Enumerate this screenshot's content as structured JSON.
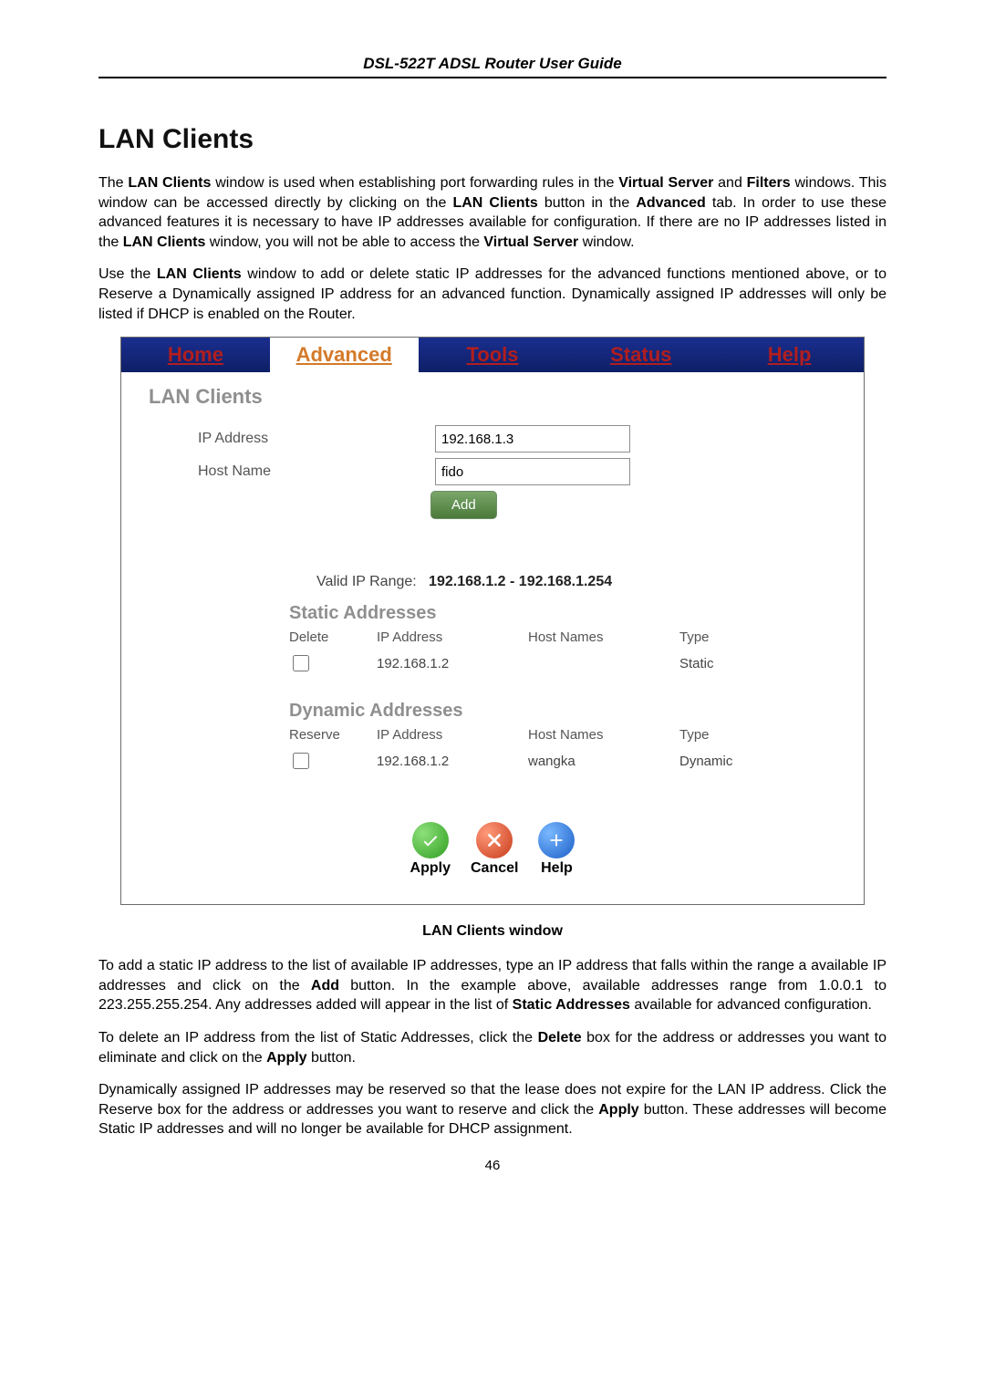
{
  "doc": {
    "header": "DSL-522T ADSL Router User Guide",
    "section_title": "LAN Clients",
    "para1_a": "The ",
    "para1_b": "LAN Clients",
    "para1_c": " window is used when establishing port forwarding rules in the ",
    "para1_d": "Virtual Server",
    "para1_e": " and ",
    "para1_f": "Filters",
    "para1_g": " windows. This window can be accessed directly by clicking on the ",
    "para1_h": "LAN Clients",
    "para1_i": " button in the ",
    "para1_j": "Advanced",
    "para1_k": " tab. In order to use these advanced features it is necessary to have IP addresses available for configuration. If there are no IP addresses listed in the ",
    "para1_l": "LAN Clients",
    "para1_m": " window, you will not be able to access the ",
    "para1_n": "Virtual Server",
    "para1_o": " window.",
    "para2_a": "Use the ",
    "para2_b": "LAN Clients",
    "para2_c": " window to add or delete static IP addresses for the advanced functions mentioned above, or to Reserve a Dynamically assigned IP address for an advanced function. Dynamically assigned IP addresses will only be listed if DHCP is enabled on the Router.",
    "figcap": "LAN Clients window",
    "para3_a": "To add a static IP address to the list of available IP addresses, type an IP address that falls within the range a available IP addresses and click on the ",
    "para3_b": "Add",
    "para3_c": " button. In the example above, available addresses range from 1.0.0.1 to 223.255.255.254. Any addresses added will appear in the list of ",
    "para3_d": "Static Addresses",
    "para3_e": " available for advanced configuration.",
    "para4_a": "To delete an IP address from the list of Static Addresses, click the ",
    "para4_b": "Delete",
    "para4_c": " box for the address or addresses you want to eliminate and click on the ",
    "para4_d": "Apply",
    "para4_e": " button.",
    "para5_a": "Dynamically assigned IP addresses may be reserved so that the lease does not expire for the LAN IP address. Click the Reserve box for the address or addresses you want to reserve and click the ",
    "para5_b": "Apply",
    "para5_c": " button. These addresses will become Static IP addresses and will no longer be available for DHCP assignment.",
    "page_number": "46"
  },
  "ui": {
    "nav": {
      "home": "Home",
      "advanced": "Advanced",
      "tools": "Tools",
      "status": "Status",
      "help": "Help"
    },
    "page_title": "LAN Clients",
    "form": {
      "ip_label": "IP Address",
      "ip_value": "192.168.1.3",
      "host_label": "Host Name",
      "host_value": "fido",
      "add_label": "Add"
    },
    "range": {
      "label": "Valid IP Range:",
      "from": "192.168.1.2",
      "sep": " - ",
      "to": "192.168.1.254"
    },
    "static": {
      "title": "Static Addresses",
      "cols": {
        "delete": "Delete",
        "ip": "IP Address",
        "host": "Host Names",
        "type": "Type"
      },
      "rows": [
        {
          "ip": "192.168.1.2",
          "host": "",
          "type": "Static"
        }
      ]
    },
    "dynamic": {
      "title": "Dynamic Addresses",
      "cols": {
        "reserve": "Reserve",
        "ip": "IP Address",
        "host": "Host Names",
        "type": "Type"
      },
      "rows": [
        {
          "ip": "192.168.1.2",
          "host": "wangka",
          "type": "Dynamic"
        }
      ]
    },
    "actions": {
      "apply": "Apply",
      "cancel": "Cancel",
      "help": "Help"
    }
  }
}
